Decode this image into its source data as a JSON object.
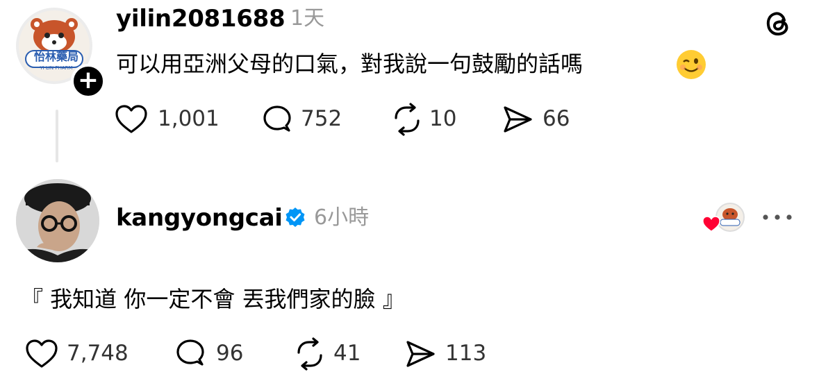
{
  "post": {
    "username": "yilin2081688",
    "time": "1天",
    "text": "可以用亞洲父母的口氣，對我說一句鼓勵的話嗎",
    "avatar_text": "怡林藥局",
    "avatar_subtext": "YI LIN PHARM",
    "stats": {
      "likes": "1,001",
      "replies": "752",
      "reposts": "10",
      "shares": "66"
    }
  },
  "reply": {
    "username": "kangyongcai",
    "time": "6小時",
    "text": "『 我知道 你一定不會 丟我們家的臉 』",
    "stats": {
      "likes": "7,748",
      "replies": "96",
      "reposts": "41",
      "shares": "113"
    }
  },
  "colors": {
    "accent": "#ff2d55",
    "verified": "#0095f6",
    "muted": "#999999",
    "avatar_blue": "#2a5db0"
  },
  "icons": [
    "threads-logo-icon",
    "plus-icon",
    "heart-icon",
    "comment-icon",
    "repost-icon",
    "share-icon",
    "verified-icon",
    "more-icon",
    "liked-heart-icon"
  ]
}
